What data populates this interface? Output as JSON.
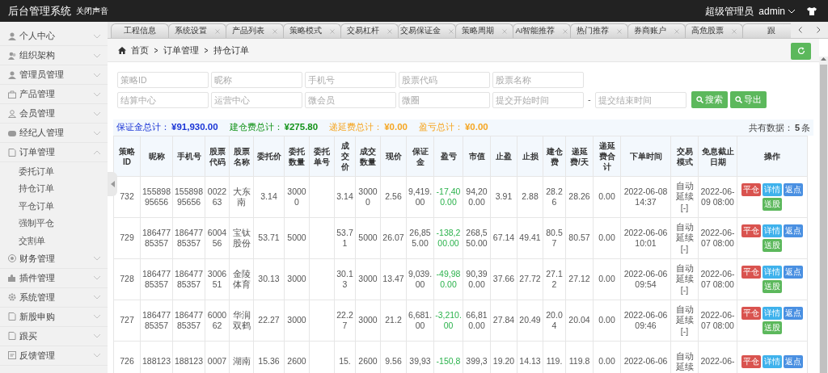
{
  "header": {
    "title": "后台管理系统",
    "sound_toggle": "关闭声音",
    "role": "超级管理员",
    "user": "admin"
  },
  "sidebar": {
    "items": [
      {
        "label": "个人中心",
        "expanded": false
      },
      {
        "label": "组织架构",
        "expanded": false
      },
      {
        "label": "管理员管理",
        "expanded": false
      },
      {
        "label": "产品管理",
        "expanded": false
      },
      {
        "label": "会员管理",
        "expanded": false
      },
      {
        "label": "经纪人管理",
        "expanded": false
      },
      {
        "label": "订单管理",
        "expanded": true,
        "children": [
          {
            "label": "委托订单"
          },
          {
            "label": "持仓订单"
          },
          {
            "label": "平仓订单"
          },
          {
            "label": "强制平仓"
          },
          {
            "label": "交割单"
          }
        ]
      },
      {
        "label": "财务管理",
        "expanded": false
      },
      {
        "label": "插件管理",
        "expanded": false
      },
      {
        "label": "系统管理",
        "expanded": false
      },
      {
        "label": "新股申购",
        "expanded": false
      },
      {
        "label": "跟买",
        "expanded": false
      },
      {
        "label": "反馈管理",
        "expanded": false
      }
    ]
  },
  "tabs": [
    {
      "label": "工程信息",
      "closable": false
    },
    {
      "label": "系统设置",
      "closable": true
    },
    {
      "label": "产品列表",
      "closable": true
    },
    {
      "label": "策略模式",
      "closable": true
    },
    {
      "label": "交易杠杆",
      "closable": true
    },
    {
      "label": "交易保证金",
      "closable": true
    },
    {
      "label": "策略周期",
      "closable": true
    },
    {
      "label": "AI智能推荐",
      "closable": true
    },
    {
      "label": "热门推荐",
      "closable": true
    },
    {
      "label": "券商账户",
      "closable": true
    },
    {
      "label": "高危股票",
      "closable": true
    },
    {
      "label": "跟",
      "closable": false
    }
  ],
  "breadcrumb": [
    "首页",
    "订单管理",
    "持仓订单"
  ],
  "search": {
    "fields": [
      {
        "placeholder": "策略ID"
      },
      {
        "placeholder": "昵称"
      },
      {
        "placeholder": "手机号"
      },
      {
        "placeholder": "股票代码"
      },
      {
        "placeholder": "股票名称"
      }
    ],
    "fields_2": [
      {
        "placeholder": "结算中心"
      },
      {
        "placeholder": "运营中心"
      },
      {
        "placeholder": "微会员"
      },
      {
        "placeholder": "微圈"
      }
    ],
    "date_from": {
      "placeholder": "提交开始时间"
    },
    "separator": "-",
    "date_to": {
      "placeholder": "提交结束时间"
    },
    "buttons": [
      "搜索",
      "导出"
    ]
  },
  "summary": {
    "totals": [
      {
        "label": "保证金总计：",
        "value": "¥91,930.00",
        "color": "#1a35d6"
      },
      {
        "label": "建仓费总计：",
        "value": "¥275.80",
        "color": "#14931a"
      },
      {
        "label": "递延费总计：",
        "value": "¥0.00",
        "color": "#f5a623"
      },
      {
        "label": "盈亏总计：",
        "value": "¥0.00",
        "color": "#f5a623"
      }
    ],
    "count_label": "共有数据：",
    "count": "5",
    "count_unit": "条"
  },
  "table": {
    "columns": [
      {
        "label": "策略ID",
        "kind": "text"
      },
      {
        "label": "昵称",
        "kind": "text"
      },
      {
        "label": "手机号",
        "kind": "text"
      },
      {
        "label": "股票代码",
        "kind": "text"
      },
      {
        "label": "股票名称",
        "kind": "text"
      },
      {
        "label": "委托价",
        "kind": "text"
      },
      {
        "label": "委托数量",
        "kind": "text"
      },
      {
        "label": "委托单号",
        "kind": "text"
      },
      {
        "label": "成交价",
        "kind": "text"
      },
      {
        "label": "成交数量",
        "kind": "text"
      },
      {
        "label": "现价",
        "kind": "text"
      },
      {
        "label": "保证金",
        "kind": "text"
      },
      {
        "label": "盈亏",
        "kind": "profit"
      },
      {
        "label": "市值",
        "kind": "text"
      },
      {
        "label": "止盈",
        "kind": "text"
      },
      {
        "label": "止损",
        "kind": "text"
      },
      {
        "label": "建仓费",
        "kind": "text"
      },
      {
        "label": "递延费/天",
        "kind": "text"
      },
      {
        "label": "递延费合计",
        "kind": "text"
      },
      {
        "label": "下单时间",
        "kind": "date"
      },
      {
        "label": "交易模式",
        "kind": "mode"
      },
      {
        "label": "免息截止日期",
        "kind": "text"
      },
      {
        "label": "操作",
        "kind": "actions"
      }
    ],
    "rows": [
      {
        "cells": [
          "732",
          "15589895656",
          "15589895656",
          "002263",
          "大东南",
          "3.14",
          "30000",
          null,
          "3.14",
          "30000",
          "2.56",
          "9,419.00",
          "-17,400.00",
          "94,200.00",
          "3.91",
          "2.88",
          "28.26",
          "28.26",
          "0.00",
          "2022-06-08 14:37",
          {
            "text": "自动延续",
            "link": "[-]"
          },
          "2022-06-09 08:00",
          [
            {
              "label": "平仓",
              "kind": "danger"
            },
            {
              "label": "详情",
              "kind": "info"
            },
            {
              "label": "返点",
              "kind": "primary"
            },
            {
              "label": "送股",
              "kind": "success"
            }
          ]
        ]
      },
      {
        "cells": [
          "729",
          "18647785357",
          "18647785357",
          "600456",
          "宝钛股份",
          "53.71",
          "5000",
          null,
          "53.71",
          "5000",
          "26.07",
          "26,855.00",
          "-138,200.00",
          "268,550.00",
          "67.14",
          "49.41",
          "80.57",
          "80.57",
          "0.00",
          "2022-06-06 10:01",
          {
            "text": "自动延续",
            "link": "[-]"
          },
          "2022-06-07 08:00",
          [
            {
              "label": "平仓",
              "kind": "danger"
            },
            {
              "label": "详情",
              "kind": "info"
            },
            {
              "label": "返点",
              "kind": "primary"
            },
            {
              "label": "送股",
              "kind": "success"
            }
          ]
        ]
      },
      {
        "cells": [
          "728",
          "18647785357",
          "18647785357",
          "300651",
          "金陵体育",
          "30.13",
          "3000",
          null,
          "30.13",
          "3000",
          "13.47",
          "9,039.00",
          "-49,980.00",
          "90,390.00",
          "37.66",
          "27.72",
          "27.12",
          "27.12",
          "0.00",
          "2022-06-06 09:54",
          {
            "text": "自动延续",
            "link": "[-]"
          },
          "2022-06-07 08:00",
          [
            {
              "label": "平仓",
              "kind": "danger"
            },
            {
              "label": "详情",
              "kind": "info"
            },
            {
              "label": "返点",
              "kind": "primary"
            },
            {
              "label": "送股",
              "kind": "success"
            }
          ]
        ]
      },
      {
        "cells": [
          "727",
          "18647785357",
          "18647785357",
          "600062",
          "华润双鹤",
          "22.27",
          "3000",
          null,
          "22.27",
          "3000",
          "21.2",
          "6,681.00",
          "-3,210.00",
          "66,810.00",
          "27.84",
          "20.49",
          "20.04",
          "20.04",
          "0.00",
          "2022-06-06 09:46",
          {
            "text": "自动延续",
            "link": "[-]"
          },
          "2022-06-07 08:00",
          [
            {
              "label": "平仓",
              "kind": "danger"
            },
            {
              "label": "详情",
              "kind": "info"
            },
            {
              "label": "返点",
              "kind": "primary"
            },
            {
              "label": "送股",
              "kind": "success"
            }
          ]
        ]
      },
      {
        "cells": [
          "726",
          "188123",
          "188123",
          "0007",
          "湖南",
          "15.36",
          "2600",
          null,
          "15.",
          "2600",
          "9.56",
          "39,93",
          "-150,8",
          "399,3",
          "19.20",
          "14.13",
          "119.",
          "119.8",
          "0.00",
          "2022-06-06",
          {
            "text": "自动延续"
          },
          "2022-06-",
          [
            {
              "label": "平仓",
              "kind": "danger"
            },
            {
              "label": "详情",
              "kind": "info"
            },
            {
              "label": "返点",
              "kind": "primary"
            }
          ]
        ]
      }
    ]
  }
}
